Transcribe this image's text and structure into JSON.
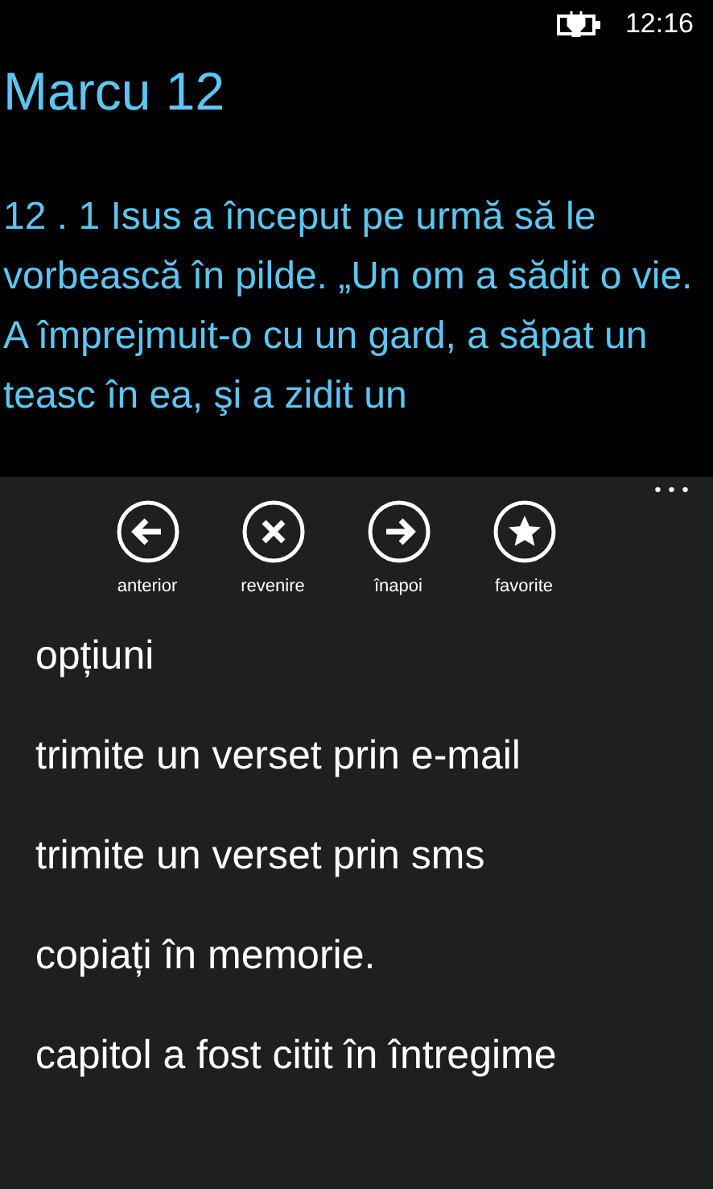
{
  "status_bar": {
    "time": "12:16"
  },
  "title": "Marcu 12",
  "verse": "12 . 1 Isus a început pe urmă să le vorbească în pilde. „Un om a sădit o vie. A împrejmuit-o cu un gard, a săpat un teasc în ea, şi a zidit un",
  "app_bar": {
    "buttons": [
      {
        "kind": "back",
        "label": "anterior"
      },
      {
        "kind": "close",
        "label": "revenire"
      },
      {
        "kind": "forward",
        "label": "înapoi"
      },
      {
        "kind": "star",
        "label": "favorite"
      }
    ],
    "more": "•••"
  },
  "menu": [
    "opțiuni",
    "trimite un verset prin e-mail",
    "trimite un verset prin sms",
    "copiați în memorie.",
    "capitol a fost citit în întregime"
  ]
}
